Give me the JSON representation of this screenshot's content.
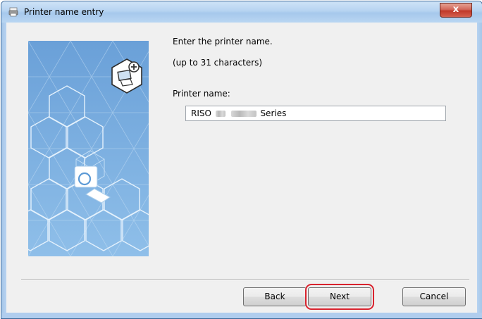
{
  "window": {
    "title": "Printer name entry",
    "close_label": "x"
  },
  "content": {
    "instruction": "Enter the printer name.",
    "limit": "(up to 31 characters)",
    "field_label": "Printer name:"
  },
  "printer_name": {
    "prefix": "RISO",
    "suffix": "Series"
  },
  "buttons": {
    "back": "Back",
    "next": "Next",
    "cancel": "Cancel"
  },
  "colors": {
    "art_background": "#7aaee0",
    "highlight": "#d9232e",
    "close_button": "#c0382a"
  },
  "icons": [
    "printer-app-icon",
    "add-printer-icon",
    "printer-illustration-icon",
    "close-icon"
  ]
}
